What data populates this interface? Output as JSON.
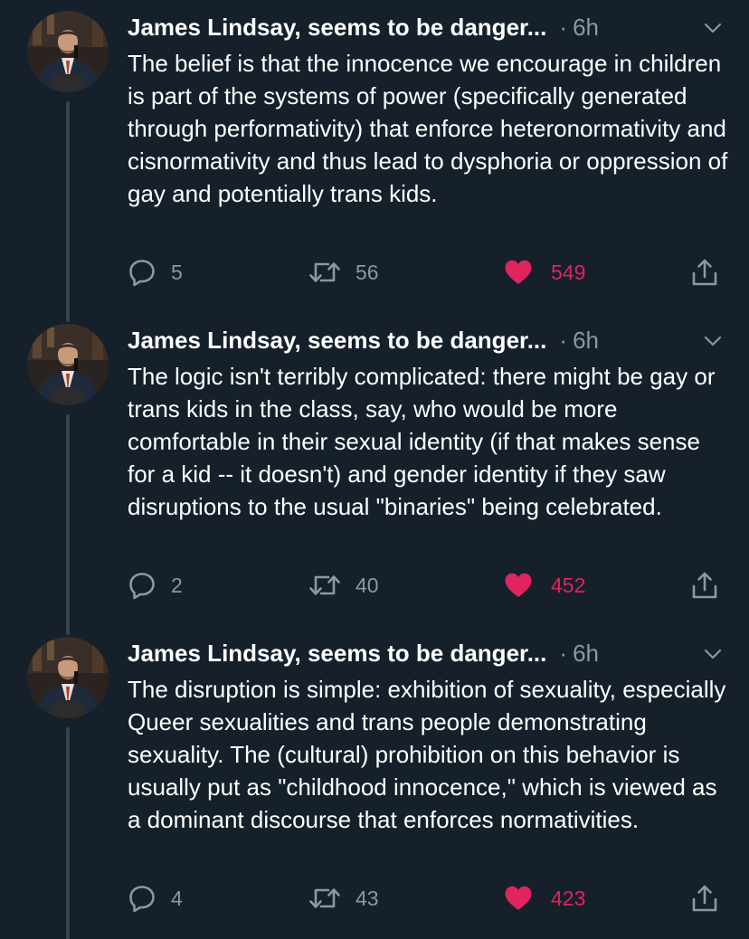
{
  "colors": {
    "background": "#15202b",
    "text_primary": "#ffffff",
    "text_secondary": "#8899a6",
    "like_active": "#e0245e",
    "thread_line": "#38444d"
  },
  "tweets": [
    {
      "author_display": "James Lindsay, seems to be danger...",
      "separator": "·",
      "timestamp": "6h",
      "text": "The belief is that the innocence we encourage in children is part of the systems of power (specifically generated through performativity) that enforce heteronormativity and cisnormativity and thus lead to dysphoria or oppression of gay and potentially trans kids.",
      "replies": "5",
      "retweets": "56",
      "likes": "549",
      "liked": true
    },
    {
      "author_display": "James Lindsay, seems to be danger...",
      "separator": "·",
      "timestamp": "6h",
      "text": "The logic isn't terribly complicated: there might be gay or trans kids in the class, say, who would be more comfortable in their sexual identity (if that makes sense for a kid -- it doesn't) and gender identity if they saw disruptions to the usual \"binaries\" being celebrated.",
      "replies": "2",
      "retweets": "40",
      "likes": "452",
      "liked": true
    },
    {
      "author_display": "James Lindsay, seems to be danger...",
      "separator": "·",
      "timestamp": "6h",
      "text": "The disruption is simple: exhibition of sexuality, especially Queer sexualities and trans people demonstrating sexuality. The (cultural) prohibition on this behavior is usually put as \"childhood innocence,\" which is viewed as a dominant discourse that enforces normativities.",
      "replies": "4",
      "retweets": "43",
      "likes": "423",
      "liked": true
    }
  ],
  "icons": {
    "avatar": "avatar-photo",
    "more": "chevron-down-icon",
    "reply": "reply-icon",
    "retweet": "retweet-icon",
    "like": "heart-icon",
    "share": "share-icon"
  }
}
